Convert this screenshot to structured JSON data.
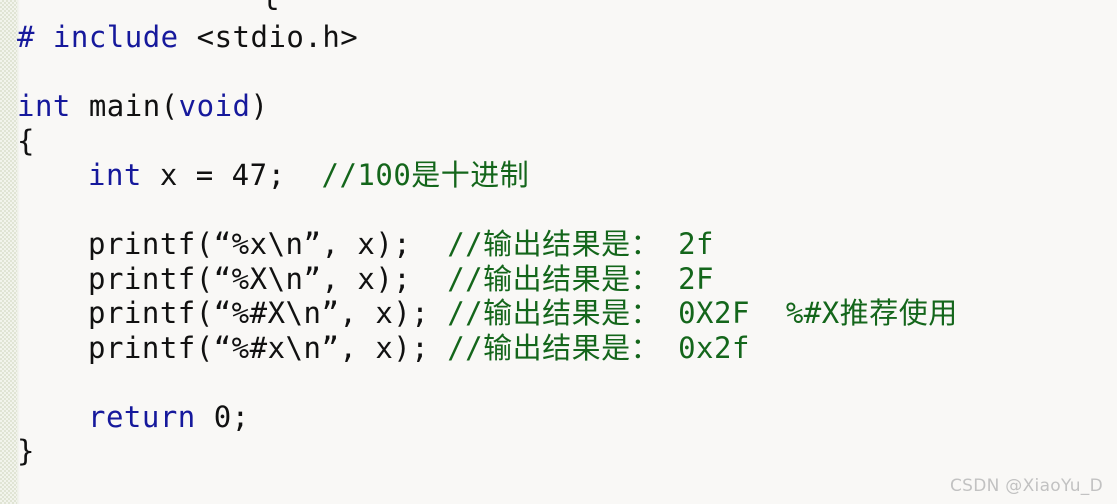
{
  "editor": {
    "background_color": "#f9f8f6",
    "gutter_color": "#dfe3d3",
    "keyword_color": "#16199c",
    "comment_color": "#14661b",
    "text_color": "#111111",
    "top_fragment": "l"
  },
  "code": {
    "lines": [
      {
        "id": "include-line",
        "indent": 0,
        "segments": [
          {
            "type": "kw",
            "text": "# include "
          },
          {
            "type": "plain",
            "text": "<stdio.h>"
          }
        ]
      },
      {
        "id": "blank-1",
        "indent": 0,
        "segments": [
          {
            "type": "plain",
            "text": ""
          }
        ]
      },
      {
        "id": "main-signature",
        "indent": 0,
        "segments": [
          {
            "type": "kw",
            "text": "int "
          },
          {
            "type": "plain",
            "text": "main("
          },
          {
            "type": "kw",
            "text": "void"
          },
          {
            "type": "plain",
            "text": ")"
          }
        ]
      },
      {
        "id": "open-brace",
        "indent": 0,
        "segments": [
          {
            "type": "plain",
            "text": "{"
          }
        ]
      },
      {
        "id": "declare-x",
        "indent": 1,
        "segments": [
          {
            "type": "kw",
            "text": "int "
          },
          {
            "type": "plain",
            "text": "x = 47;  "
          },
          {
            "type": "comment",
            "text": "//100是十进制"
          }
        ]
      },
      {
        "id": "blank-2",
        "indent": 0,
        "segments": [
          {
            "type": "plain",
            "text": ""
          }
        ]
      },
      {
        "id": "printf-lower-x",
        "indent": 1,
        "segments": [
          {
            "type": "plain",
            "text": "printf(“%x\\n”, x);  "
          },
          {
            "type": "comment",
            "text": "//输出结果是： 2f"
          }
        ]
      },
      {
        "id": "printf-upper-x",
        "indent": 1,
        "segments": [
          {
            "type": "plain",
            "text": "printf(“%X\\n”, x);  "
          },
          {
            "type": "comment",
            "text": "//输出结果是： 2F"
          }
        ]
      },
      {
        "id": "printf-hash-upper-x",
        "indent": 1,
        "segments": [
          {
            "type": "plain",
            "text": "printf(“%#X\\n”, x); "
          },
          {
            "type": "comment",
            "text": "//输出结果是： 0X2F  %#X推荐使用"
          }
        ]
      },
      {
        "id": "printf-hash-lower-x",
        "indent": 1,
        "segments": [
          {
            "type": "plain",
            "text": "printf(“%#x\\n”, x); "
          },
          {
            "type": "comment",
            "text": "//输出结果是： 0x2f"
          }
        ]
      },
      {
        "id": "blank-3",
        "indent": 0,
        "segments": [
          {
            "type": "plain",
            "text": ""
          }
        ]
      },
      {
        "id": "return-line",
        "indent": 1,
        "segments": [
          {
            "type": "kw",
            "text": "return "
          },
          {
            "type": "plain",
            "text": "0;"
          }
        ]
      },
      {
        "id": "close-brace",
        "indent": 0,
        "segments": [
          {
            "type": "plain",
            "text": "}"
          }
        ]
      }
    ]
  },
  "watermark": {
    "text": "CSDN @XiaoYu_D"
  }
}
